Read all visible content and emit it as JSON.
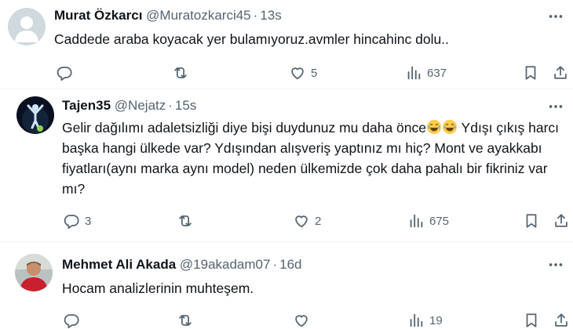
{
  "tweets": [
    {
      "name": "Murat Özkarcı",
      "handle": "@Muratozkarci45",
      "time": "13s",
      "text": "Caddede araba koyacak yer bulamıyoruz.avmler hincahinc dolu..",
      "replies": "",
      "reposts": "",
      "likes": "5",
      "views": "637",
      "avatar": "default-avatar"
    },
    {
      "name": "Tajen35",
      "handle": "@Nejatz",
      "time": "15s",
      "text_part1": "Gelir dağılımı adaletsizliği diye bişi duydunuz mu daha önce",
      "text_part2": " Ydışı çıkış harcı başka hangi ülkede var? Ydışından alışveriş yaptınız mı hiç? Mont ve ayakkabı fiyatları(aynı marka aynı model) neden ülkemizde çok daha pahalı bir fikriniz var mı?",
      "emoji": "joy-emoji",
      "replies": "3",
      "reposts": "",
      "likes": "2",
      "views": "675",
      "avatar": "figure-photo"
    },
    {
      "name": "Mehmet Ali Akada",
      "handle": "@19akadam07",
      "time": "16d",
      "text": "Hocam analizlerinin muhteşem.",
      "replies": "",
      "reposts": "",
      "likes": "",
      "views": "19",
      "avatar": "person-photo"
    }
  ],
  "colors": {
    "text": "#0f1419",
    "secondary": "#536471",
    "divider": "#eff3f4"
  }
}
